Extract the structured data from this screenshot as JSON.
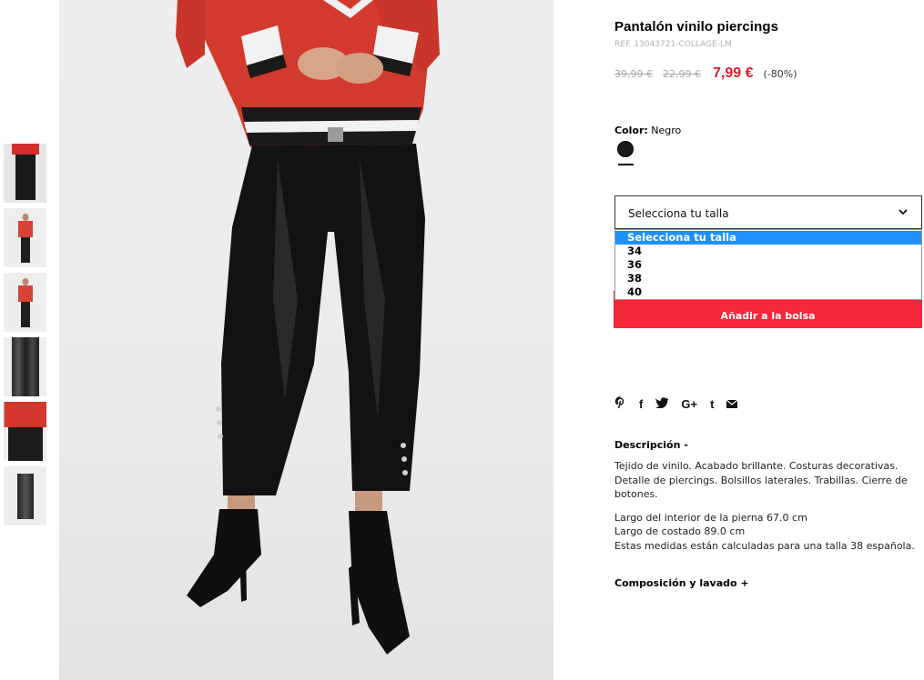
{
  "product": {
    "title": "Pantalón vinilo piercings",
    "ref": "REF. 13043721-COLLAGE-LM",
    "old_price_1": "39,99 €",
    "old_price_2": "22,99 €",
    "price": "7,99 €",
    "discount": "(-80%)"
  },
  "color": {
    "label": "Color:",
    "value": "Negro",
    "swatch_hex": "#1b1b1b"
  },
  "size": {
    "selected": "Selecciona tu talla",
    "options": [
      "Selecciona tu talla",
      "34",
      "36",
      "38",
      "40"
    ]
  },
  "cart": {
    "add_label": "Añadir a la bolsa"
  },
  "social": {
    "icons": [
      "pinterest-icon",
      "facebook-icon",
      "twitter-icon",
      "google-plus-icon",
      "tumblr-icon",
      "email-icon"
    ],
    "glyphs": [
      "℗",
      "f",
      "🐦",
      "G+",
      "t",
      "✉"
    ]
  },
  "description": {
    "heading": "Descripción  -",
    "paragraph_1": "Tejido de vinilo. Acabado brillante. Costuras decorativas. Detalle de piercings. Bolsillos laterales. Trabillas. Cierre de botones.",
    "measure_1": "Largo del interior de la pierna 67.0 cm",
    "measure_2": "Largo de costado 89.0 cm",
    "measure_3": "Estas medidas están calculadas para una talla 38 española."
  },
  "composition": {
    "heading": "Composición y lavado  +"
  },
  "colors": {
    "accent_red": "#e01b2a",
    "button_red": "#f5273a",
    "dropdown_highlight": "#1e90ff"
  }
}
